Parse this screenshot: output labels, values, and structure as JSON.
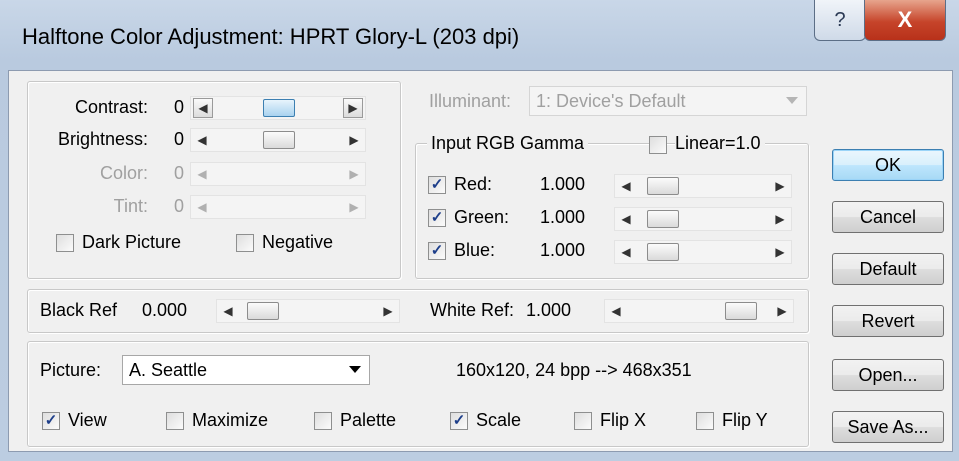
{
  "window": {
    "title": "Halftone Color Adjustment: HPRT Glory-L (203 dpi)",
    "help_glyph": "?",
    "close_glyph": "X"
  },
  "adjust": {
    "contrast": {
      "label": "Contrast:",
      "value": "0",
      "level": 0.5
    },
    "brightness": {
      "label": "Brightness:",
      "value": "0",
      "level": 0.5
    },
    "color": {
      "label": "Color:",
      "value": "0"
    },
    "tint": {
      "label": "Tint:",
      "value": "0"
    },
    "dark_picture": {
      "label": "Dark Picture",
      "checked": false
    },
    "negative": {
      "label": "Negative",
      "checked": false
    }
  },
  "illuminant": {
    "label": "Illuminant:",
    "value": "1: Device's Default"
  },
  "gamma": {
    "title": "Input RGB Gamma",
    "linear": {
      "label": "Linear=1.0",
      "checked": false
    },
    "red": {
      "label": "Red:",
      "value": "1.000",
      "checked": true
    },
    "green": {
      "label": "Green:",
      "value": "1.000",
      "checked": true
    },
    "blue": {
      "label": "Blue:",
      "value": "1.000",
      "checked": true
    }
  },
  "refs": {
    "black": {
      "label": "Black Ref",
      "value": "0.000"
    },
    "white": {
      "label": "White Ref:",
      "value": "1.000"
    }
  },
  "picture": {
    "label": "Picture:",
    "value": "A. Seattle",
    "info": "160x120, 24 bpp  --> 468x351",
    "options": {
      "view": {
        "label": "View",
        "checked": true
      },
      "maximize": {
        "label": "Maximize",
        "checked": false
      },
      "palette": {
        "label": "Palette",
        "checked": false
      },
      "scale": {
        "label": "Scale",
        "checked": true
      },
      "flip_x": {
        "label": "Flip X",
        "checked": false
      },
      "flip_y": {
        "label": "Flip Y",
        "checked": false
      }
    }
  },
  "buttons": {
    "ok": "OK",
    "cancel": "Cancel",
    "default": "Default",
    "revert": "Revert",
    "open": "Open...",
    "save_as": "Save As..."
  },
  "check_glyph": "✓",
  "arrow_left": "◀",
  "arrow_right": "▶"
}
